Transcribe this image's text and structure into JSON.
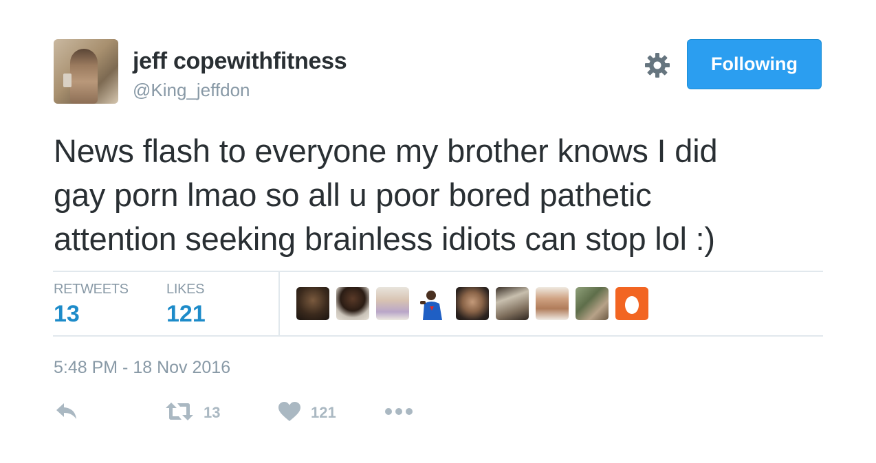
{
  "author": {
    "display_name": "jeff copewithfitness",
    "handle": "@King_jeffdon"
  },
  "header": {
    "follow_label": "Following",
    "settings_icon": "gear-icon"
  },
  "tweet": {
    "text_lines": [
      "News flash to everyone my brother knows I did",
      "gay porn lmao so all u poor bored pathetic",
      "attention seeking brainless idiots can stop lol :)"
    ],
    "timestamp": "5:48 PM - 18 Nov 2016"
  },
  "stats": {
    "retweets_label": "RETWEETS",
    "retweets_value": "13",
    "likes_label": "LIKES",
    "likes_value": "121"
  },
  "likers": [
    {
      "icon": "user-avatar"
    },
    {
      "icon": "user-avatar"
    },
    {
      "icon": "user-avatar"
    },
    {
      "icon": "user-avatar"
    },
    {
      "icon": "user-avatar"
    },
    {
      "icon": "user-avatar"
    },
    {
      "icon": "user-avatar"
    },
    {
      "icon": "user-avatar"
    },
    {
      "icon": "default-egg-avatar"
    }
  ],
  "actions": {
    "reply_icon": "reply-icon",
    "retweet_icon": "retweet-icon",
    "retweet_count": "13",
    "like_icon": "heart-icon",
    "like_count": "121",
    "more_icon": "more-icon"
  },
  "colors": {
    "accent_blue": "#1d8bc9",
    "button_blue": "#2b9ef0",
    "muted_gray": "#8899a6",
    "action_gray": "#aab8c2",
    "egg_orange": "#f26522"
  }
}
